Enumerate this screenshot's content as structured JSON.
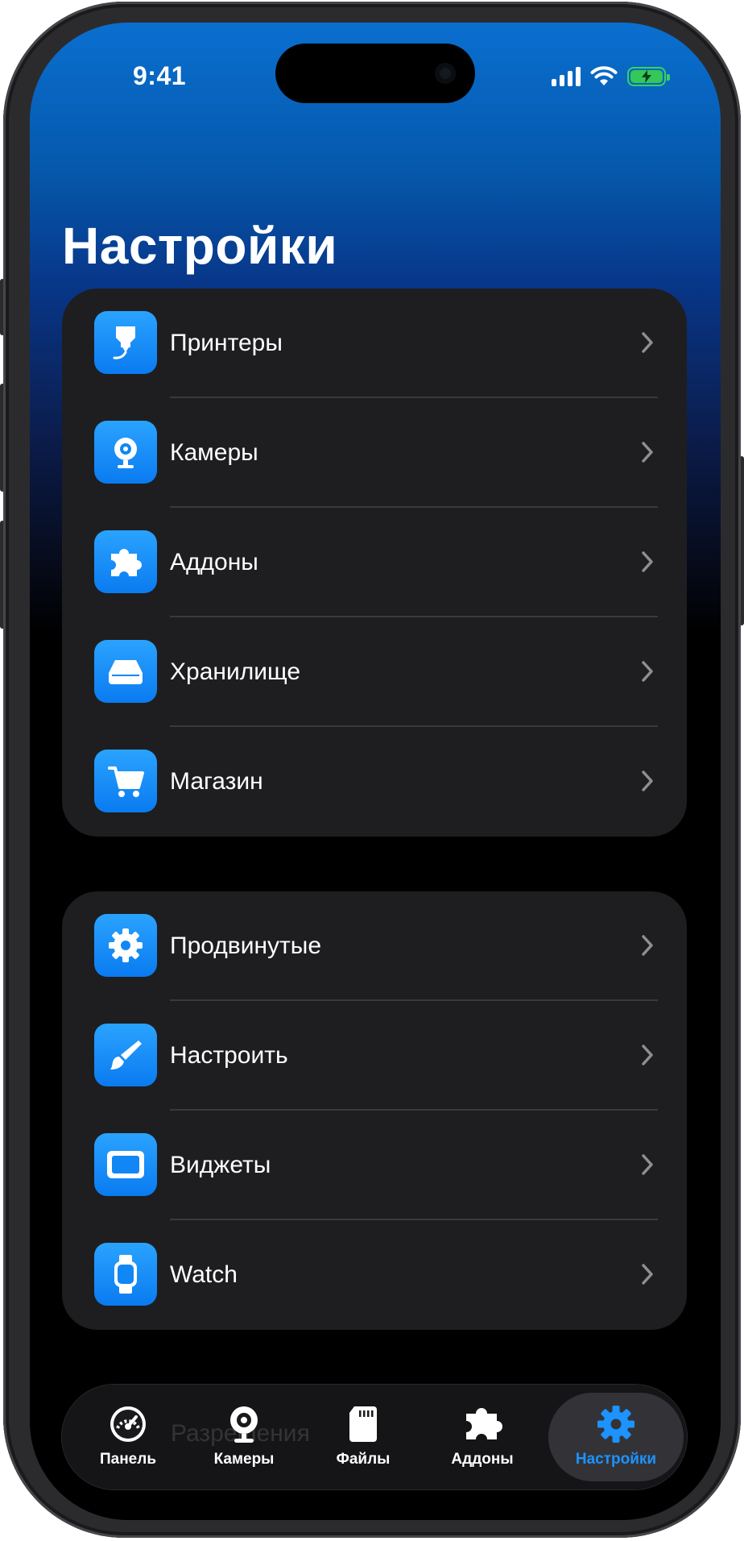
{
  "status_bar": {
    "time": "9:41"
  },
  "page": {
    "title": "Настройки"
  },
  "groups": [
    {
      "items": [
        {
          "label": "Принтеры",
          "icon": "printer-nozzle-icon"
        },
        {
          "label": "Камеры",
          "icon": "webcam-icon"
        },
        {
          "label": "Аддоны",
          "icon": "puzzle-icon"
        },
        {
          "label": "Хранилище",
          "icon": "drive-icon"
        },
        {
          "label": "Магазин",
          "icon": "cart-icon"
        }
      ]
    },
    {
      "items": [
        {
          "label": "Продвинутые",
          "icon": "gear-icon"
        },
        {
          "label": "Настроить",
          "icon": "paintbrush-icon"
        },
        {
          "label": "Виджеты",
          "icon": "widget-icon"
        },
        {
          "label": "Watch",
          "icon": "watch-icon"
        }
      ]
    }
  ],
  "tabbar": {
    "ghost_rows": [
      "Разрешения"
    ],
    "tabs": [
      {
        "label": "Панель",
        "icon": "gauge-icon",
        "active": false
      },
      {
        "label": "Камеры",
        "icon": "webcam-icon",
        "active": false
      },
      {
        "label": "Файлы",
        "icon": "sd-card-icon",
        "active": false
      },
      {
        "label": "Аддоны",
        "icon": "puzzle-icon",
        "active": false
      },
      {
        "label": "Настройки",
        "icon": "gear-icon",
        "active": true
      }
    ]
  },
  "colors": {
    "accent": "#1d93ff",
    "icon_tile_top": "#2aa3ff",
    "icon_tile_bottom": "#0a7bf0",
    "group_background": "#1e1e20",
    "header_gradient_top": "#0a6fd0",
    "battery": "#34c759"
  }
}
